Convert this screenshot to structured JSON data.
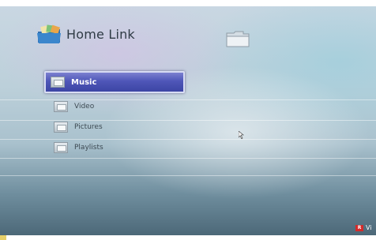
{
  "app": {
    "title": "Home Link",
    "icon": "home-link-icon"
  },
  "menu": {
    "items": [
      {
        "label": "Music",
        "icon": "folder-icon",
        "selected": true
      },
      {
        "label": "Video",
        "icon": "folder-icon",
        "selected": false
      },
      {
        "label": "Pictures",
        "icon": "folder-icon",
        "selected": false
      },
      {
        "label": "Playlists",
        "icon": "folder-icon",
        "selected": false
      }
    ]
  },
  "footer": {
    "key_label": "R",
    "hint_text": "Vi",
    "key_color": "#d42a2a"
  },
  "colors": {
    "selection": "#4f56b8",
    "background": "#bcd0da"
  }
}
